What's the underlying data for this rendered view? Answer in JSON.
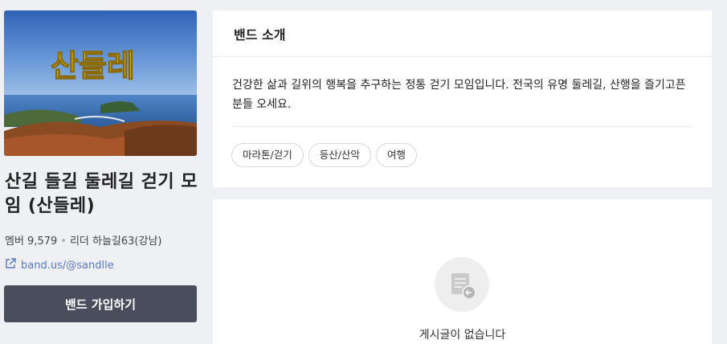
{
  "band": {
    "cover_text": "산들레",
    "title": "산길 들길 둘레길 걷기 모임 (산들레)",
    "members": "멤버 9,579",
    "leader": "리더 하늘길63(강남)",
    "link": "band.us/@sandlle",
    "link_icon": "external-link-icon",
    "join_label": "밴드 가입하기"
  },
  "intro": {
    "heading": "밴드 소개",
    "description": "건강한 삶과 길위의 행복을 추구하는 정통 걷기 모임입니다. 전국의 유명 둘레길, 산행을 즐기고픈 분들 오세요.",
    "tags": [
      "마라톤/걷기",
      "등산/산악",
      "여행"
    ]
  },
  "empty_state": {
    "icon": "document-return-icon",
    "message": "게시글이 없습니다"
  },
  "colors": {
    "page_bg": "#eef0f4",
    "button_bg": "#4a4e5c",
    "link": "#5a78c8",
    "cover_text": "#f3dc32"
  }
}
